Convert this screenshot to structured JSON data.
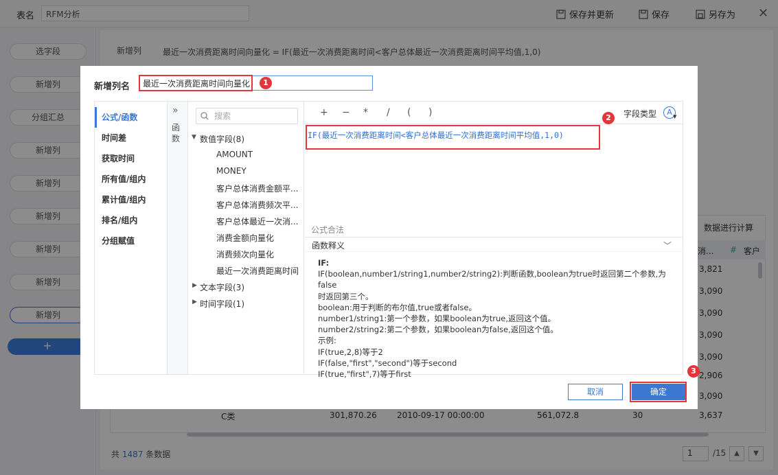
{
  "topbar": {
    "table_label": "表名",
    "table_name": "RFM分析",
    "save_update": "保存并更新",
    "save": "保存",
    "save_as": "另存为"
  },
  "sidebar": {
    "items": [
      "选字段",
      "新增列",
      "分组汇总",
      "新增列",
      "新增列",
      "新增列",
      "新增列",
      "新增列",
      "新增列"
    ],
    "add": "+"
  },
  "main": {
    "formula_label": "新增列",
    "formula_text": "最近一次消费距离时间向量化 = IF(最近一次消费距离时间<客户总体最近一次消费距离时间平均值,1,0)"
  },
  "bg_table": {
    "header_right": "数据进行计算",
    "col_a": "消...",
    "col_b": "客户",
    "right_values": [
      "3,821",
      "3,090",
      "3,090",
      "3,090",
      "3,090",
      "2,906",
      "3,090",
      "3,637"
    ],
    "last_row": [
      "C类",
      "301,870.26",
      "2010-09-17 00:00:00",
      "561,072.8",
      "30",
      "3,637"
    ],
    "footer_prefix": "共",
    "footer_count": "1487",
    "footer_suffix": "条数据",
    "page_current": "1",
    "page_total": "/15"
  },
  "dialog": {
    "name_label": "新增列名",
    "name_value": "最近一次消费距离时间向量化",
    "categories": [
      "公式/函数",
      "时间差",
      "获取时间",
      "所有值/组内",
      "累计值/组内",
      "排名/组内",
      "分组赋值"
    ],
    "fn_toggle": "函数",
    "search_placeholder": "搜索",
    "tree": {
      "numeric_group": "数值字段(8)",
      "numeric_items": [
        "AMOUNT",
        "MONEY",
        "客户总体消费金额平...",
        "客户总体消费频次平...",
        "客户总体最近一次消...",
        "消费金额向量化",
        "消费频次向量化",
        "最近一次消费距离时间"
      ],
      "text_group": "文本字段(3)",
      "time_group": "时间字段(1)"
    },
    "operators": [
      "+",
      "−",
      "*",
      "/",
      "(",
      ")"
    ],
    "field_type_label": "字段类型",
    "formula_prefix": "IF(",
    "formula_field1": "最近一次消费距离时间",
    "formula_op": "<",
    "formula_field2": "客户总体最近一次消费距离时间平均值",
    "formula_suffix": ",1,0)",
    "formula_status": "公式合法",
    "desc_title": "函数释义",
    "desc_lines": [
      "IF:",
      "IF(boolean,number1/string1,number2/string2):判断函数,boolean为true时返回第二个参数,为false",
      "时返回第三个。",
      "boolean:用于判断的布尔值,true或者false。",
      "number1/string1:第一个参数，如果boolean为true,返回这个值。",
      "number2/string2:第二个参数，如果boolean为false,返回这个值。",
      "示例:",
      "IF(true,2,8)等于2",
      "IF(false,\"first\",\"second\")等于second",
      "IF(true,\"first\",7)等于first"
    ],
    "cancel": "取消",
    "confirm": "确定",
    "badges": [
      "1",
      "2",
      "3"
    ]
  }
}
